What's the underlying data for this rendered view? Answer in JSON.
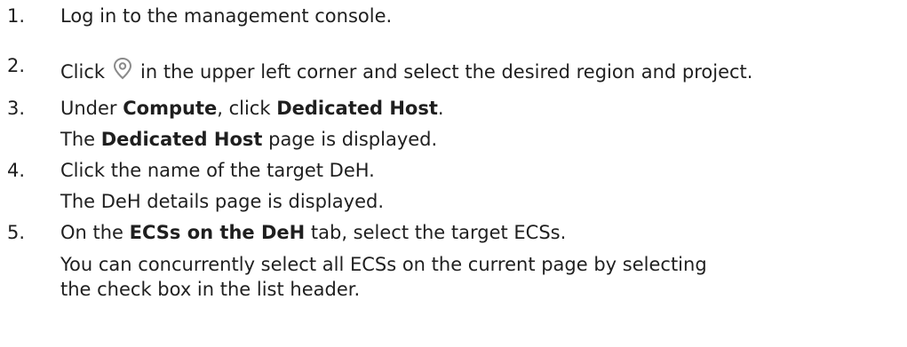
{
  "steps": [
    {
      "number": "1.",
      "text": "Log in to the management console."
    },
    {
      "number": "2.",
      "text_before": "Click",
      "icon": "location-pin-icon",
      "text_after": "in the upper left corner and select the desired region and project."
    },
    {
      "number": "3.",
      "text_before": "Under ",
      "bold1": "Compute",
      "text_mid": ", click ",
      "bold2": "Dedicated Host",
      "text_after": ".",
      "result_before": "The ",
      "result_bold": "Dedicated Host",
      "result_after": " page is displayed."
    },
    {
      "number": "4.",
      "text": "Click the name of the target DeH.",
      "result": "The DeH details page is displayed."
    },
    {
      "number": "5.",
      "text_before": "On the ",
      "bold": "ECSs on the DeH",
      "text_after": " tab, select the target ECSs.",
      "note": "You can concurrently select all ECSs on the current page by selecting the check box in the list header."
    }
  ],
  "colors": {
    "text": "#1f1f1f",
    "icon": "#8a8a8a"
  }
}
